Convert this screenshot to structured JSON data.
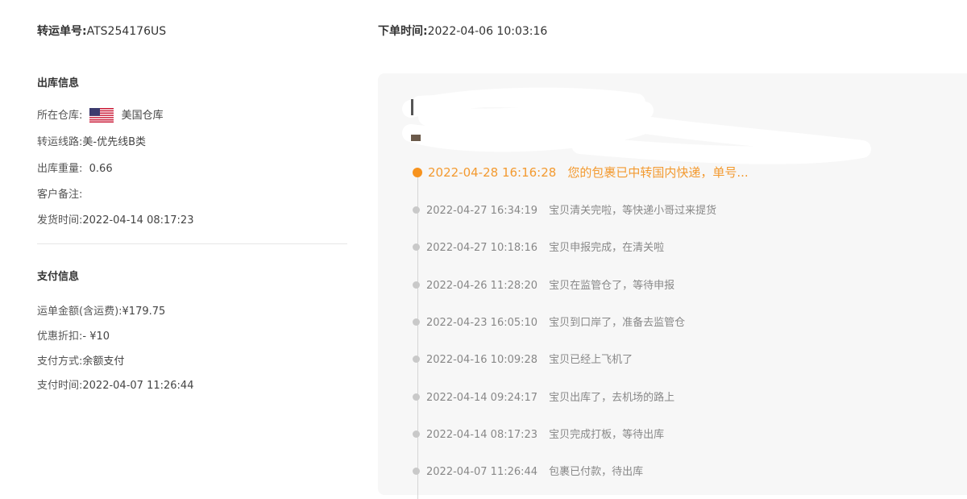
{
  "header": {
    "order_no_label": "转运单号:",
    "order_no": "ATS254176US",
    "order_time_label": "下单时间:",
    "order_time": "2022-04-06 10:03:16"
  },
  "outbound": {
    "title": "出库信息",
    "warehouse_label": "所在仓库:",
    "warehouse_flag_icon": "us-flag-icon",
    "warehouse": "美国仓库",
    "route_label": "转运线路:",
    "route": "美-优先线B类",
    "weight_label": "出库重量:",
    "weight": "0.66",
    "remark_label": "客户备注:",
    "remark": "",
    "ship_time_label": "发货时间:",
    "ship_time": "2022-04-14 08:17:23"
  },
  "payment": {
    "title": "支付信息",
    "amount_label": "运单金额(含运费):",
    "amount": "¥179.75",
    "discount_label": "优惠折扣:",
    "discount": "- ¥10",
    "method_label": "支付方式:",
    "method": "余额支付",
    "time_label": "支付时间:",
    "time": "2022-04-07 11:26:44"
  },
  "tracking": {
    "accent_color": "#f39a30",
    "events": [
      {
        "time": "2022-04-28 16:16:28",
        "desc": "您的包裹已中转国内快递，单号..."
      },
      {
        "time": "2022-04-27 16:34:19",
        "desc": "宝贝清关完啦，等快递小哥过来提货"
      },
      {
        "time": "2022-04-27 10:18:16",
        "desc": "宝贝申报完成，在清关啦"
      },
      {
        "time": "2022-04-26 11:28:20",
        "desc": "宝贝在监管仓了，等待申报"
      },
      {
        "time": "2022-04-23 16:05:10",
        "desc": "宝贝到口岸了，准备去监管仓"
      },
      {
        "time": "2022-04-16 10:09:28",
        "desc": "宝贝已经上飞机了"
      },
      {
        "time": "2022-04-14 09:24:17",
        "desc": "宝贝出库了，去机场的路上"
      },
      {
        "time": "2022-04-14 08:17:23",
        "desc": "宝贝完成打板，等待出库"
      },
      {
        "time": "2022-04-07 11:26:44",
        "desc": "包裹已付款，待出库"
      }
    ]
  }
}
